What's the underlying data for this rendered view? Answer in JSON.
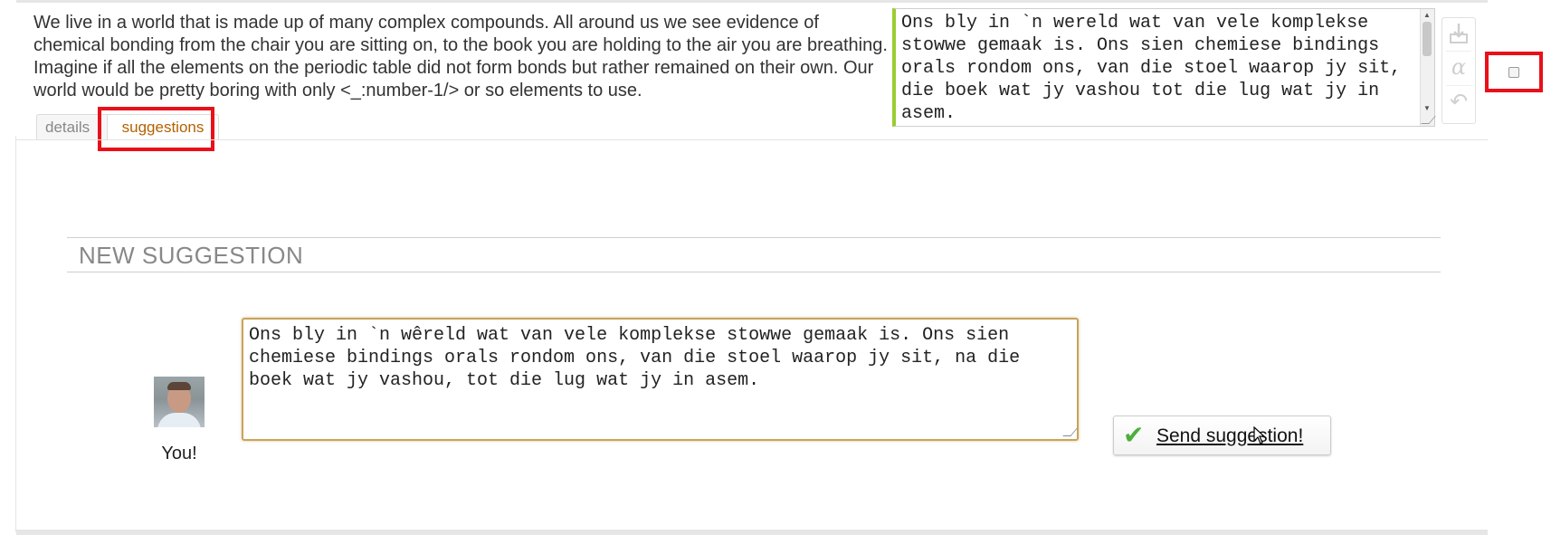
{
  "source": {
    "text": "We live in a world that is made up of many complex compounds. All around us we see evidence of chemical bonding from the chair you are sitting on, to the book you are holding to the air you are breathing. Imagine if all the elements on the periodic table did not form bonds but rather remained on their own. Our world would be pretty boring with only <_:number-1/> or so elements to use."
  },
  "tabs": {
    "details": "details",
    "suggestions": "suggestions"
  },
  "target": {
    "text": "Ons bly in `n wereld wat van vele komplekse stowwe gemaak is. Ons sien chemiese bindings orals rondom ons, van die stoel waarop jy sit, die boek wat jy vashou tot die lug wat jy in asem."
  },
  "tools": {
    "copy_icon": "copy-source-icon",
    "alpha_icon": "special-characters-icon",
    "undo_icon": "undo-icon"
  },
  "new_suggestion": {
    "heading": "NEW SUGGESTION",
    "user_label": "You!",
    "text": "Ons bly in `n wêreld wat van vele komplekse stowwe gemaak is. Ons sien chemiese bindings orals rondom ons, van die stoel waarop jy sit, na die boek wat jy vashou, tot die lug wat jy in asem.",
    "send_label": "Send suggestion!"
  },
  "colors": {
    "highlight": "#e8101a",
    "accent_green": "#9acd32",
    "tab_active": "#b36200"
  }
}
